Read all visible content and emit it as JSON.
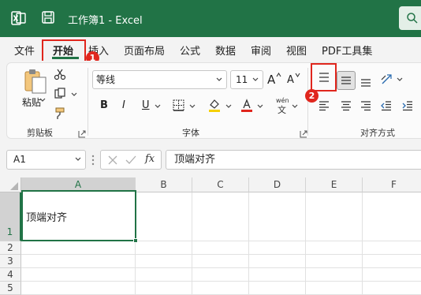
{
  "titlebar": {
    "doc_title": "工作簿1  -  Excel"
  },
  "tabs": [
    {
      "id": "file",
      "label": "文件"
    },
    {
      "id": "home",
      "label": "开始"
    },
    {
      "id": "insert",
      "label": "插入"
    },
    {
      "id": "page_layout",
      "label": "页面布局"
    },
    {
      "id": "formulas",
      "label": "公式"
    },
    {
      "id": "data",
      "label": "数据"
    },
    {
      "id": "review",
      "label": "审阅"
    },
    {
      "id": "view",
      "label": "视图"
    },
    {
      "id": "pdf",
      "label": "PDF工具集"
    }
  ],
  "annotations": {
    "badge1": "1",
    "badge2": "2"
  },
  "ribbon": {
    "clipboard": {
      "paste_label": "粘贴",
      "group_label": "剪贴板"
    },
    "font": {
      "font_name": "等线",
      "font_size": "11",
      "grow": "A",
      "shrink": "A",
      "bold": "B",
      "italic": "I",
      "underline": "U",
      "group_label": "字体",
      "phonetic_top": "wén",
      "phonetic_bottom": "文"
    },
    "alignment": {
      "group_label": "对齐方式"
    }
  },
  "formula_bar": {
    "name_box": "A1",
    "fx_label": "fx",
    "content": "顶端对齐"
  },
  "sheet": {
    "columns": [
      "A",
      "B",
      "C",
      "D",
      "E",
      "F"
    ],
    "rows": [
      "1",
      "2",
      "3",
      "4",
      "5"
    ],
    "selected_column": "A",
    "selected_row": "1",
    "cell_a1": "顶端对齐"
  },
  "colors": {
    "brand": "#217346",
    "highlight": "#e0261d",
    "font_color": "#e0261d",
    "fill_color": "#f5d000"
  }
}
